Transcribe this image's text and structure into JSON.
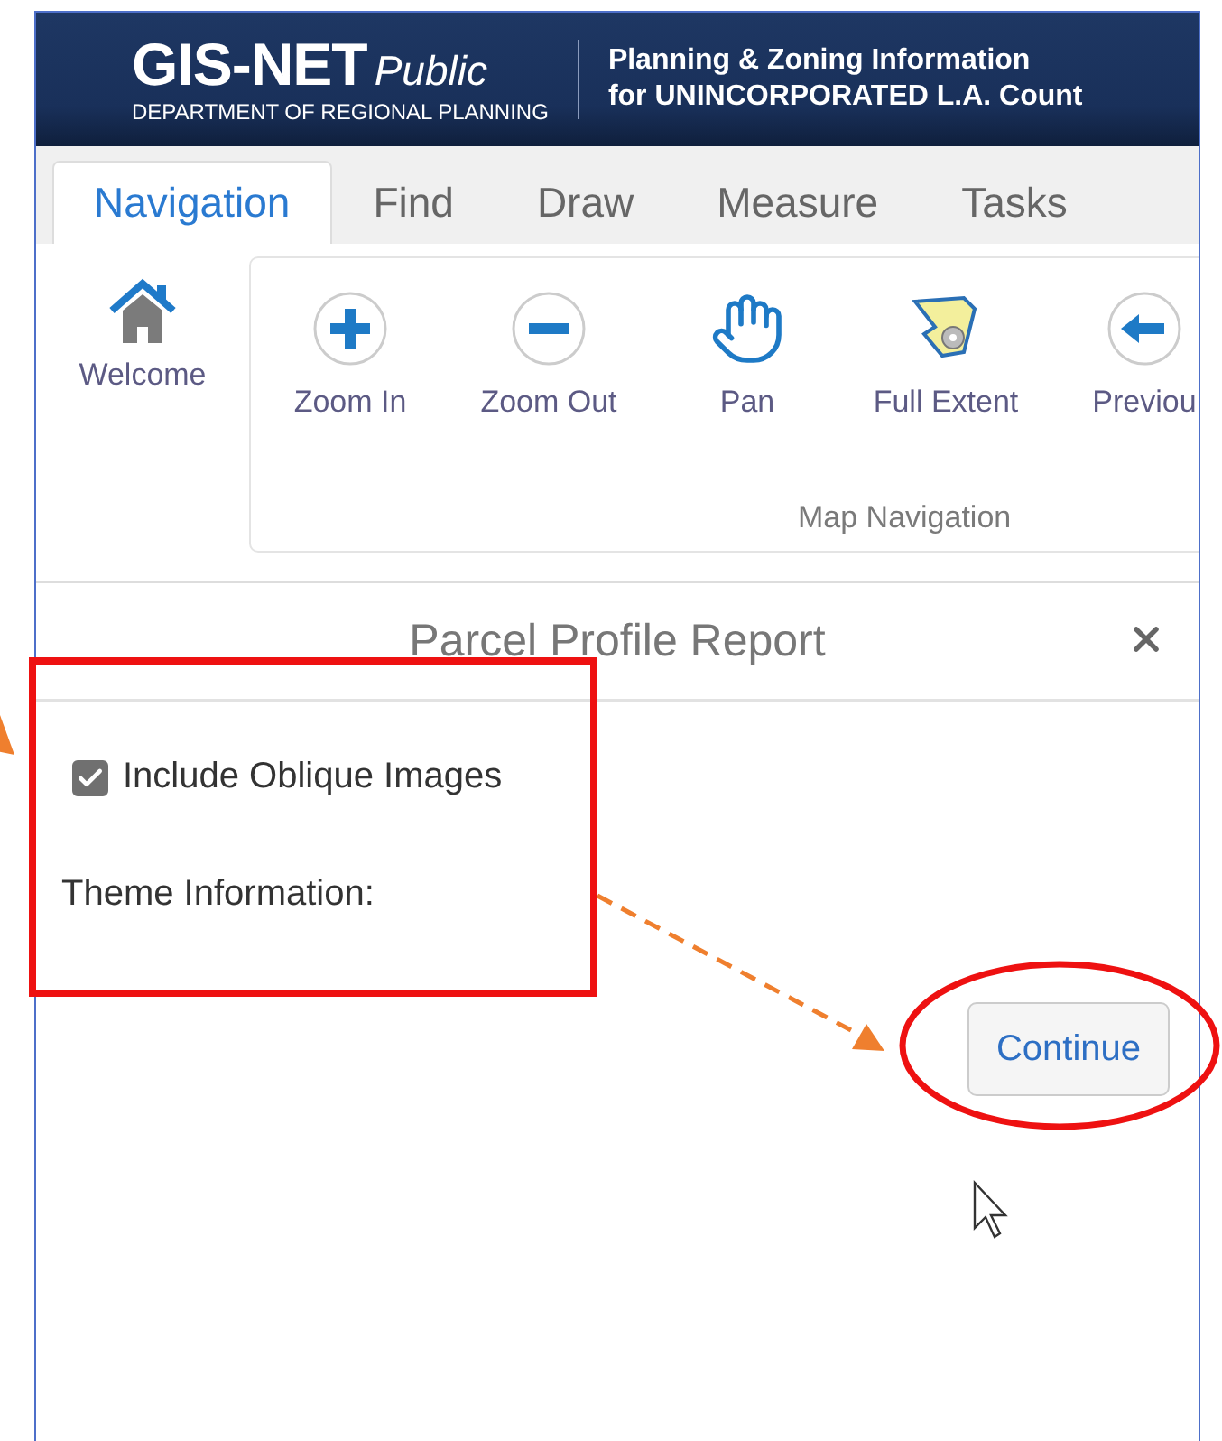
{
  "header": {
    "title": "GIS-NET",
    "subtitle": "Public",
    "department": "DEPARTMENT OF REGIONAL PLANNING",
    "info_lines": [
      "Planning & Zoning Information",
      "for UNINCORPORATED L.A. Count"
    ]
  },
  "tabs": [
    {
      "label": "Navigation",
      "selected": true
    },
    {
      "label": "Find",
      "selected": false
    },
    {
      "label": "Draw",
      "selected": false
    },
    {
      "label": "Measure",
      "selected": false
    },
    {
      "label": "Tasks",
      "selected": false
    }
  ],
  "ribbon": {
    "welcome": {
      "label": "Welcome",
      "kind": "home"
    },
    "group": {
      "label": "Map Navigation",
      "buttons": [
        {
          "label": "Zoom In",
          "kind": "zoom-in"
        },
        {
          "label": "Zoom Out",
          "kind": "zoom-out"
        },
        {
          "label": "Pan",
          "kind": "pan"
        },
        {
          "label": "Full Extent",
          "kind": "full-extent"
        },
        {
          "label": "Previou",
          "kind": "previous"
        }
      ]
    }
  },
  "dialog": {
    "title": "Parcel Profile Report",
    "checkbox": {
      "label": "Include Oblique Images",
      "checked": true
    },
    "theme_label": "Theme Information:",
    "button": "Continue"
  }
}
